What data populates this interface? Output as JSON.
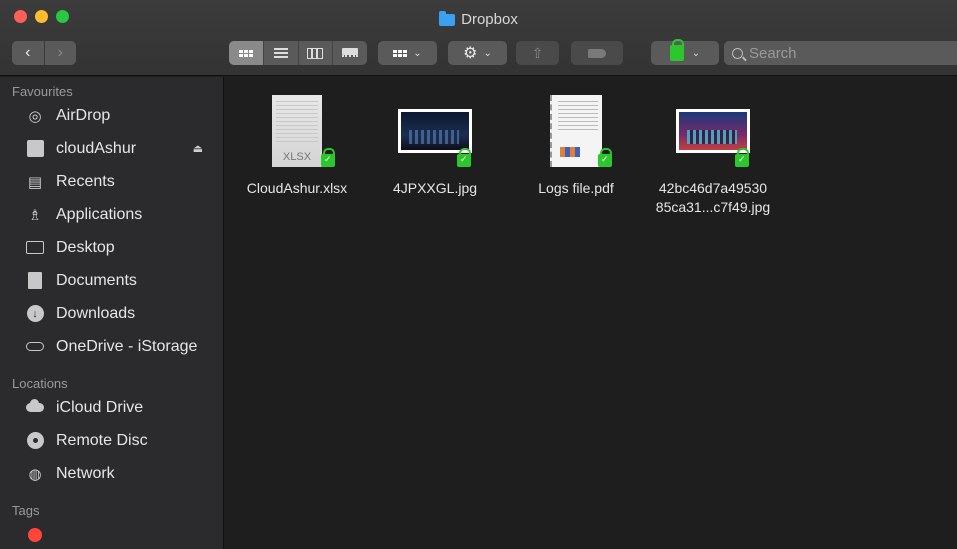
{
  "window": {
    "title": "Dropbox"
  },
  "toolbar": {
    "search_placeholder": "Search",
    "back_label": "<",
    "forward_label": ">"
  },
  "sidebar": {
    "favourites_header": "Favourites",
    "favourites": [
      {
        "label": "AirDrop",
        "icon": "airdrop-icon"
      },
      {
        "label": "cloudAshur",
        "icon": "drive-icon",
        "eject": true
      },
      {
        "label": "Recents",
        "icon": "recents-icon"
      },
      {
        "label": "Applications",
        "icon": "applications-icon"
      },
      {
        "label": "Desktop",
        "icon": "desktop-icon"
      },
      {
        "label": "Documents",
        "icon": "documents-icon"
      },
      {
        "label": "Downloads",
        "icon": "downloads-icon"
      },
      {
        "label": "OneDrive - iStorage",
        "icon": "onedrive-icon"
      }
    ],
    "locations_header": "Locations",
    "locations": [
      {
        "label": "iCloud Drive",
        "icon": "icloud-icon"
      },
      {
        "label": "Remote Disc",
        "icon": "disc-icon"
      },
      {
        "label": "Network",
        "icon": "network-icon"
      }
    ],
    "tags_header": "Tags"
  },
  "files": [
    {
      "name": "CloudAshur.xlsx",
      "type": "xlsx",
      "thumb_label": "XLSX"
    },
    {
      "name": "4JPXXGL.jpg",
      "type": "jpg"
    },
    {
      "name": "Logs file.pdf",
      "type": "pdf"
    },
    {
      "name_line1": "42bc46d7a49530",
      "name_line2": "85ca31...c7f49.jpg",
      "type": "jpg"
    }
  ],
  "colors": {
    "accent_lock": "#2cc72c",
    "folder_blue": "#3aa0f0"
  }
}
